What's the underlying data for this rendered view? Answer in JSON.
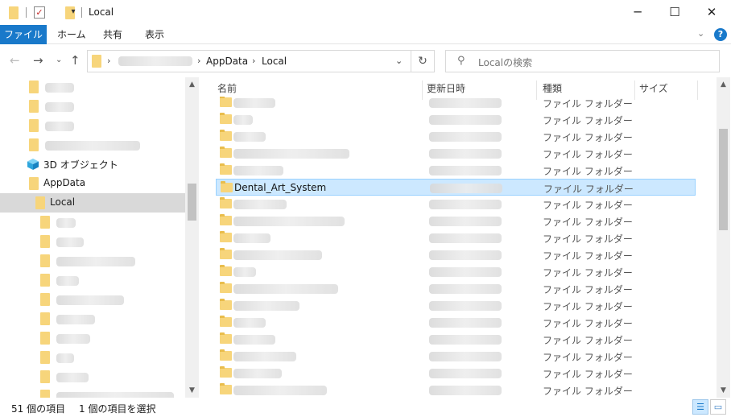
{
  "window": {
    "title": "Local"
  },
  "window_controls": {
    "minimize": "─",
    "maximize": "☐",
    "close": "✕"
  },
  "ribbon": {
    "tabs": [
      "ファイル",
      "ホーム",
      "共有",
      "表示"
    ],
    "help": "?"
  },
  "address": {
    "crumbs": [
      "AppData",
      "Local"
    ]
  },
  "search": {
    "placeholder": "Localの検索"
  },
  "nav": {
    "objects_3d": "3D オブジェクト",
    "appdata": "AppData",
    "local": "Local"
  },
  "columns": {
    "name": "名前",
    "date": "更新日時",
    "type": "種類",
    "size": "サイズ"
  },
  "files": {
    "folder_type": "ファイル フォルダー",
    "selected_name": "Dental_Art_System"
  },
  "status": {
    "count": "51 個の項目",
    "selection": "1 個の項目を選択"
  },
  "colors": {
    "accent": "#1979ca",
    "selection": "#cce8ff",
    "folder": "#f7d57b"
  }
}
